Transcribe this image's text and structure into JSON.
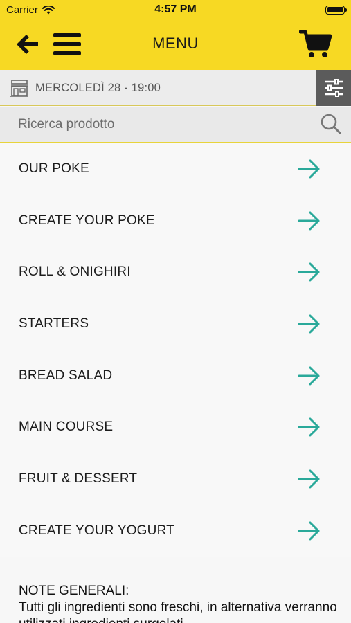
{
  "status_bar": {
    "carrier": "Carrier",
    "time": "4:57 PM"
  },
  "header": {
    "title": "MENU",
    "background": "#f7d923"
  },
  "date_bar": {
    "text": "MERCOLEDÌ 28 - 19:00"
  },
  "search": {
    "placeholder": "Ricerca prodotto"
  },
  "categories": [
    {
      "label": "OUR POKE"
    },
    {
      "label": "CREATE YOUR POKE"
    },
    {
      "label": "ROLL & ONIGHIRI"
    },
    {
      "label": "STARTERS"
    },
    {
      "label": "BREAD SALAD"
    },
    {
      "label": "MAIN COURSE"
    },
    {
      "label": "FRUIT & DESSERT"
    },
    {
      "label": "CREATE YOUR YOGURT"
    }
  ],
  "notes": {
    "title": "NOTE GENERALI:",
    "text": "Tutti gli ingredienti sono freschi, in alternativa verranno utilizzati ingredienti surgelati."
  },
  "colors": {
    "accent": "#f7d923",
    "arrow": "#2aa99a",
    "filter_bg": "#5b5b5b"
  }
}
